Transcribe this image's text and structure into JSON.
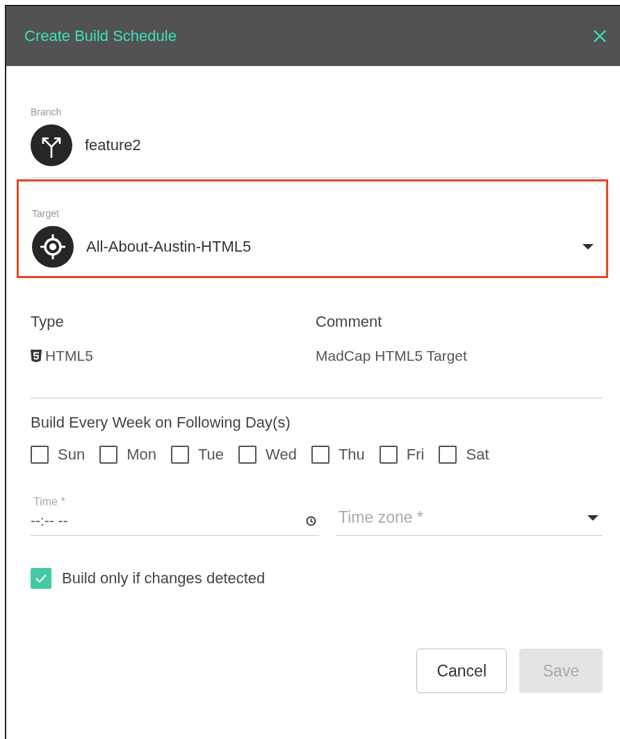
{
  "dialog": {
    "title": "Create Build Schedule"
  },
  "branch": {
    "label": "Branch",
    "value": "feature2"
  },
  "target": {
    "label": "Target",
    "value": "All-About-Austin-HTML5",
    "highlighted": true
  },
  "details": [
    {
      "label": "Type",
      "value": "HTML5",
      "kind": "html5"
    },
    {
      "label": "Comment",
      "value": "MadCap HTML5 Target",
      "kind": "plain"
    }
  ],
  "days": {
    "label": "Build Every Week on Following Day(s)",
    "items": [
      {
        "label": "Sun",
        "checked": false
      },
      {
        "label": "Mon",
        "checked": false
      },
      {
        "label": "Tue",
        "checked": false
      },
      {
        "label": "Wed",
        "checked": false
      },
      {
        "label": "Thu",
        "checked": false
      },
      {
        "label": "Fri",
        "checked": false
      },
      {
        "label": "Sat",
        "checked": false
      }
    ]
  },
  "time": {
    "label": "Time *",
    "value": "--:-- --"
  },
  "time_zone": {
    "placeholder": "Time zone *"
  },
  "changes_only": {
    "label": "Build only if changes detected",
    "checked": true
  },
  "buttons": [
    {
      "label": "Cancel",
      "disabled": false
    },
    {
      "label": "Save",
      "disabled": true
    }
  ]
}
